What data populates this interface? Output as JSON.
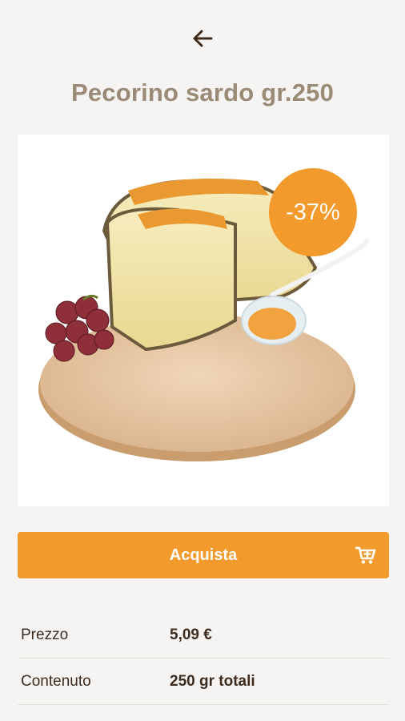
{
  "product": {
    "title": "Pecorino sardo gr.250",
    "discount_badge": "-37%"
  },
  "actions": {
    "buy_label": "Acquista"
  },
  "details": [
    {
      "label": "Prezzo",
      "value": "5,09 €"
    },
    {
      "label": "Contenuto",
      "value": "250 gr totali"
    }
  ],
  "colors": {
    "accent": "#f39a2c",
    "title": "#9a8a78",
    "text": "#3d2c20",
    "background": "#f6f4f2"
  },
  "icons": {
    "back": "arrow-left-icon",
    "cart": "cart-plus-icon"
  }
}
